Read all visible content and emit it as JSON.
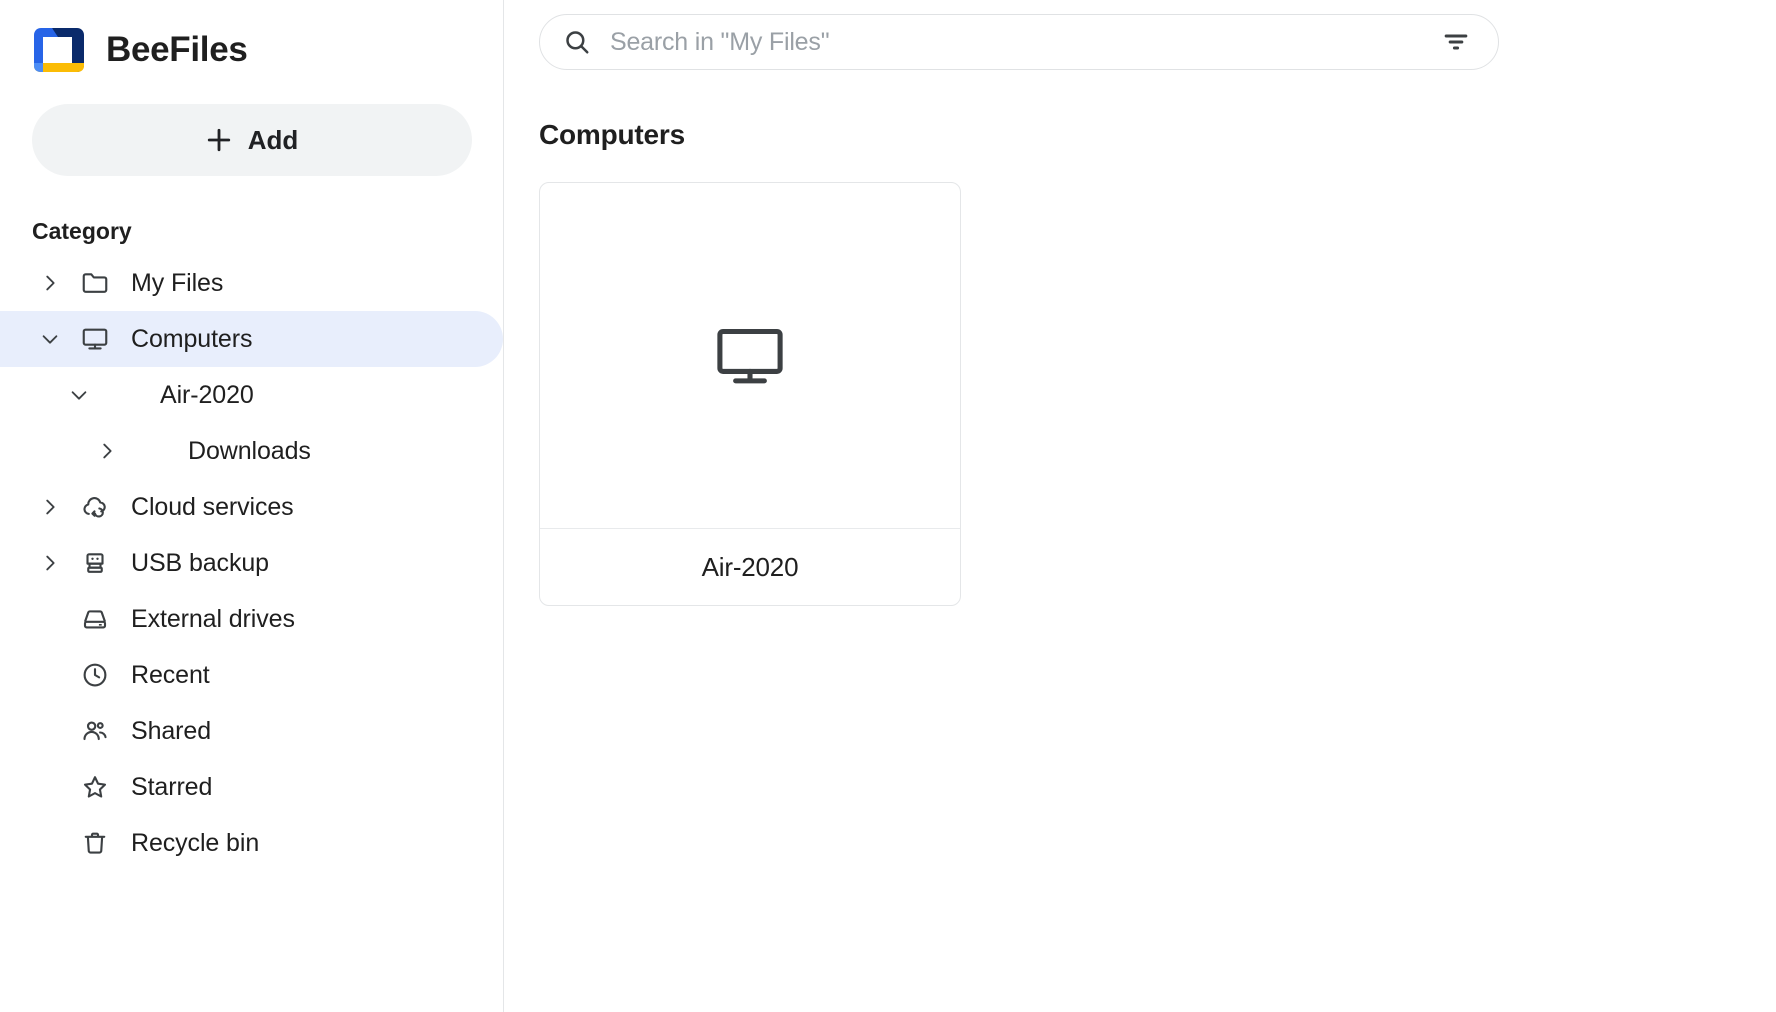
{
  "app": {
    "brand_name": "BeeFiles",
    "logo_colors": {
      "blue": "#2764E7",
      "navy": "#0A2A6B",
      "amber": "#FBBC05",
      "light_blue": "#4C8DF6"
    },
    "accent_highlight": "#E8EEFC",
    "button_bg": "#F1F3F4"
  },
  "sidebar": {
    "add_button": {
      "label": "Add",
      "icon": "plus-icon"
    },
    "section_label": "Category",
    "items": [
      {
        "label": "My Files",
        "icon": "folder-icon",
        "twisty": "chevron-right",
        "level": 1,
        "active": false
      },
      {
        "label": "Computers",
        "icon": "monitor-icon",
        "twisty": "chevron-down",
        "level": 1,
        "active": true
      },
      {
        "label": "Air-2020",
        "icon": "none",
        "twisty": "chevron-down",
        "level": 2,
        "active": false
      },
      {
        "label": "Downloads",
        "icon": "none",
        "twisty": "chevron-right",
        "level": 3,
        "active": false
      },
      {
        "label": "Cloud services",
        "icon": "cloud-sync-icon",
        "twisty": "chevron-right",
        "level": 1,
        "active": false
      },
      {
        "label": "USB backup",
        "icon": "usb-drive-icon",
        "twisty": "chevron-right",
        "level": 1,
        "active": false
      },
      {
        "label": "External drives",
        "icon": "hard-drive-icon",
        "twisty": "none",
        "level": 1,
        "active": false
      },
      {
        "label": "Recent",
        "icon": "clock-icon",
        "twisty": "none",
        "level": 1,
        "active": false
      },
      {
        "label": "Shared",
        "icon": "people-icon",
        "twisty": "none",
        "level": 1,
        "active": false
      },
      {
        "label": "Starred",
        "icon": "star-icon",
        "twisty": "none",
        "level": 1,
        "active": false
      },
      {
        "label": "Recycle bin",
        "icon": "trash-icon",
        "twisty": "none",
        "level": 1,
        "active": false
      }
    ]
  },
  "search": {
    "placeholder": "Search in \"My Files\"",
    "value": "",
    "search_icon": "search-icon",
    "filter_icon": "filter-icon"
  },
  "main": {
    "heading": "Computers",
    "cards": [
      {
        "label": "Air-2020",
        "icon": "monitor-icon"
      }
    ]
  }
}
